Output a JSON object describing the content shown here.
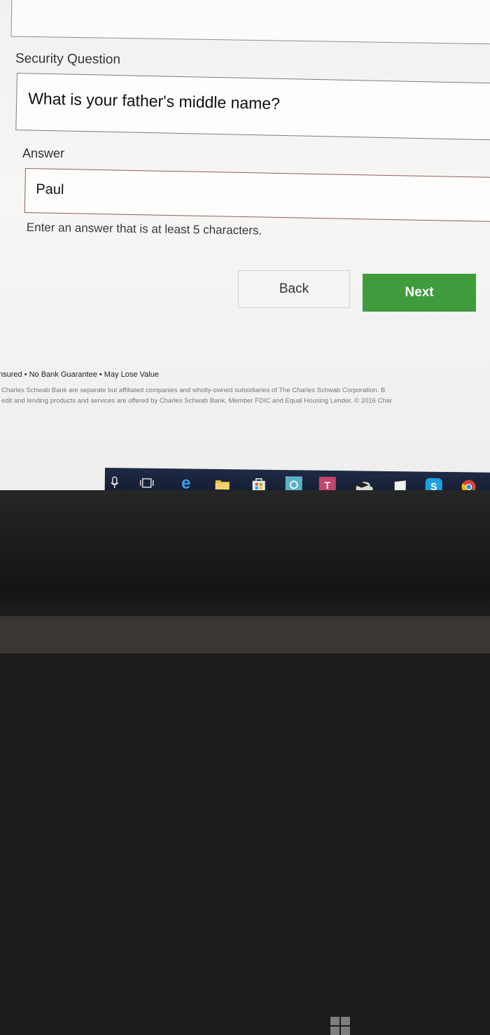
{
  "form": {
    "security_question_label": "Security Question",
    "security_question_value": "What is your father's middle name?",
    "answer_label": "Answer",
    "answer_value": "Paul",
    "answer_helper": "Enter an answer that is at least 5 characters.",
    "back_label": "Back",
    "next_label": "Next"
  },
  "footer": {
    "disclosure": "nsured • No Bank Guarantee • May Lose Value",
    "legal_line1": "Charles Schwab Bank are separate but affiliated companies and wholly-owned subsidiaries of The Charles Schwab Corporation. B",
    "legal_line2": "edit and lending products and services are offered by Charles Schwab Bank, Member FDIC and Equal Housing Lender. © 2016 Char"
  },
  "taskbar": {
    "icons": [
      "microphone-icon",
      "task-view-icon",
      "edge-icon",
      "file-explorer-icon",
      "store-icon",
      "app-icon",
      "text-app-icon",
      "weather-icon",
      "notepad-icon",
      "skype-icon",
      "chrome-icon"
    ],
    "edge_glyph": "e",
    "t_glyph": "T",
    "s_glyph": "S"
  },
  "colors": {
    "next_button": "#3f9b3c",
    "taskbar": "#1b2640"
  }
}
